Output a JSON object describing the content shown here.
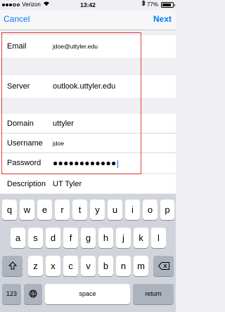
{
  "status_bar": {
    "carrier": "Verizon",
    "time": "13:42",
    "battery": "77%",
    "icons": [
      "signal-icon",
      "wifi-icon",
      "bluetooth-icon",
      "battery-icon"
    ]
  },
  "nav": {
    "cancel": "Cancel",
    "next": "Next"
  },
  "form": {
    "email_label": "Email",
    "email_value": "jdoe@uttyler.edu",
    "server_label": "Server",
    "server_value": "outlook.uttyler.edu",
    "domain_label": "Domain",
    "domain_value": "uttyler",
    "username_label": "Username",
    "username_value": "jdoe",
    "password_label": "Password",
    "password_value": "●●●●●●●●●●●●",
    "description_label": "Description",
    "description_value": "UT Tyler"
  },
  "keyboard": {
    "row1": [
      "q",
      "w",
      "e",
      "r",
      "t",
      "y",
      "u",
      "i",
      "o",
      "p"
    ],
    "row2": [
      "a",
      "s",
      "d",
      "f",
      "g",
      "h",
      "j",
      "k",
      "l"
    ],
    "row3": [
      "z",
      "x",
      "c",
      "v",
      "b",
      "n",
      "m"
    ],
    "numbers": "123",
    "space": "space",
    "return": "return",
    "icons": [
      "shift-icon",
      "backspace-icon",
      "globe-icon"
    ]
  },
  "colors": {
    "accent": "#007aff",
    "highlight_border": "#e2403d",
    "background": "#efeff4",
    "keyboard_bg": "#d1d5db"
  }
}
